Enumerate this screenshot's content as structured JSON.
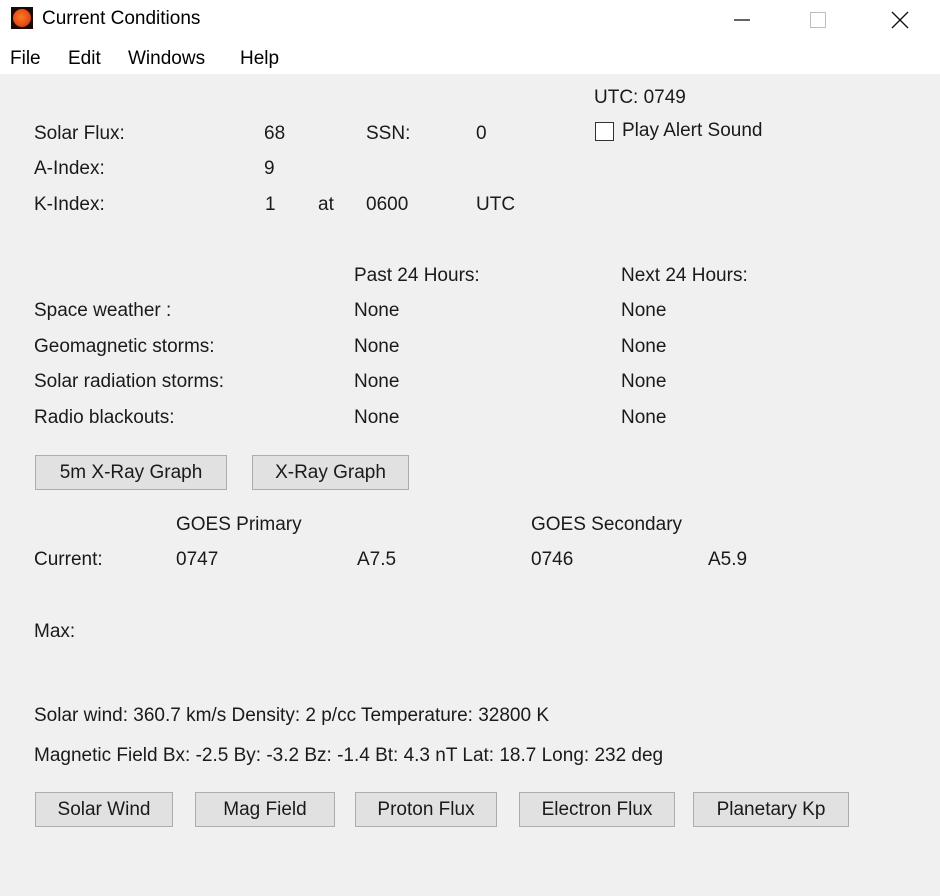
{
  "window": {
    "title": "Current Conditions",
    "icon": "sun-icon",
    "controls": {
      "minimize": "minimize-icon",
      "maximize": "maximize-icon",
      "close": "close-icon"
    }
  },
  "menu": [
    {
      "label": "File"
    },
    {
      "label": "Edit"
    },
    {
      "label": "Windows"
    },
    {
      "label": "Help"
    }
  ],
  "header": {
    "utc_label": "UTC: 0749",
    "alert_sound_label": "Play Alert Sound",
    "alert_sound_checked": false
  },
  "indices": {
    "solar_flux_label": "Solar Flux:",
    "solar_flux_value": "68",
    "ssn_label": "SSN:",
    "ssn_value": "0",
    "a_index_label": "A-Index:",
    "a_index_value": "9",
    "k_index_label": "K-Index:",
    "k_index_value": "1",
    "k_at_label": "at",
    "k_time": "0600",
    "k_tz": "UTC"
  },
  "events": {
    "past_header": "Past 24 Hours:",
    "next_header": "Next 24 Hours:",
    "rows": [
      {
        "label": "Space weather :",
        "past": "None",
        "next": "None"
      },
      {
        "label": "Geomagnetic storms:",
        "past": "None",
        "next": "None"
      },
      {
        "label": "Solar radiation storms:",
        "past": "None",
        "next": "None"
      },
      {
        "label": "Radio blackouts:",
        "past": "None",
        "next": "None"
      }
    ]
  },
  "xray_buttons": {
    "five_min": "5m X-Ray Graph",
    "xray": "X-Ray Graph"
  },
  "goes": {
    "primary_header": "GOES Primary",
    "secondary_header": "GOES Secondary",
    "current_label": "Current:",
    "primary_time": "0747",
    "primary_class": "A7.5",
    "secondary_time": "0746",
    "secondary_class": "A5.9",
    "max_label": "Max:"
  },
  "solar_wind": {
    "line": "Solar wind: 360.7 km/s  Density: 2 p/cc  Temperature: 32800 K",
    "mag_line": "Magnetic Field  Bx: -2.5  By: -3.2  Bz: -1.4  Bt: 4.3 nT  Lat: 18.7  Long: 232 deg"
  },
  "bottom_buttons": [
    {
      "label": "Solar Wind"
    },
    {
      "label": "Mag Field"
    },
    {
      "label": "Proton Flux"
    },
    {
      "label": "Electron Flux"
    },
    {
      "label": "Planetary Kp"
    }
  ]
}
